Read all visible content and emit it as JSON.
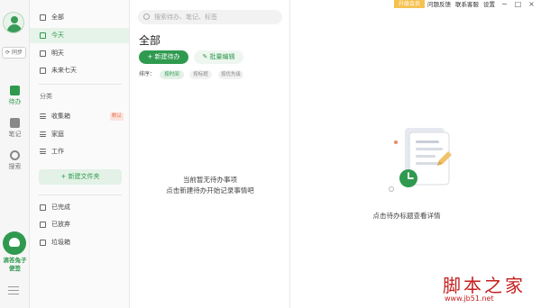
{
  "rail": {
    "sync": "同步",
    "todo": "待办",
    "note": "笔记",
    "search": "搜索",
    "brand_line1": "滴答兔子",
    "brand_line2": "便签"
  },
  "categories": {
    "smart": [
      {
        "label": "全部"
      },
      {
        "label": "今天"
      },
      {
        "label": "明天"
      },
      {
        "label": "未来七天"
      }
    ],
    "section_label": "分类",
    "folders": [
      {
        "label": "收集箱",
        "badge": "默认"
      },
      {
        "label": "家庭"
      },
      {
        "label": "工作"
      }
    ],
    "new_folder": "+ 新建文件夹",
    "status": [
      {
        "label": "已完成"
      },
      {
        "label": "已放弃"
      },
      {
        "label": "垃圾箱"
      }
    ]
  },
  "list": {
    "search_placeholder": "搜索待办、笔记、标签",
    "title": "全部",
    "new_todo": "+ 新建待办",
    "batch_edit": "批量编辑",
    "sort_label": "排序：",
    "sort_options": [
      "按时间",
      "按标题",
      "按优先级"
    ],
    "empty_line1": "当前暂无待办事项",
    "empty_line2": "点击新建待办开始记录事情吧"
  },
  "topbar": {
    "upgrade": "升级会员",
    "feedback": "问题反馈",
    "contact": "联系客服",
    "settings": "设置",
    "minimize": "−",
    "maximize": "□",
    "close": "×"
  },
  "detail": {
    "hint": "点击待办标题查看详情"
  },
  "watermark": {
    "line1": "脚本之家",
    "line2": "www.jb51.net"
  },
  "colors": {
    "accent": "#2f9a4f",
    "upgrade": "#f5c251",
    "badge": "#e86a4a"
  }
}
